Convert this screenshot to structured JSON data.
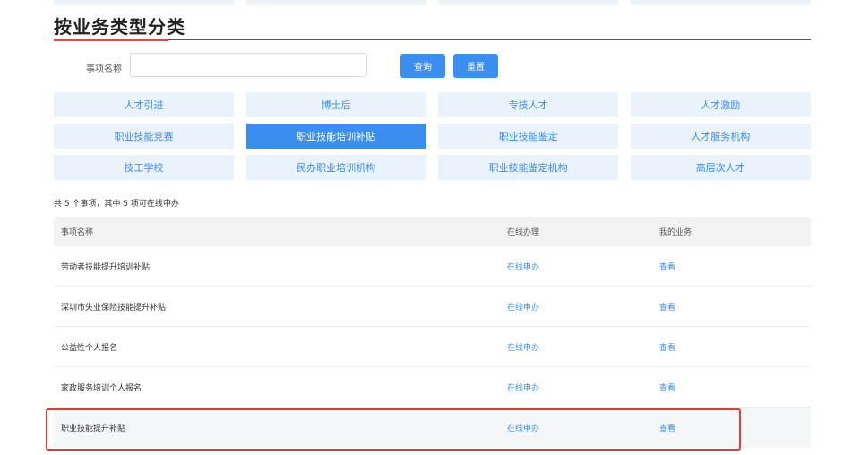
{
  "section": {
    "title": "按业务类型分类"
  },
  "search": {
    "label": "事项名称",
    "value": "",
    "placeholder": ""
  },
  "buttons": {
    "query": "查询",
    "reset": "重置"
  },
  "categories": [
    {
      "label": "人才引进",
      "active": false
    },
    {
      "label": "博士后",
      "active": false
    },
    {
      "label": "专技人才",
      "active": false
    },
    {
      "label": "人才激励",
      "active": false
    },
    {
      "label": "职业技能竞赛",
      "active": false
    },
    {
      "label": "职业技能培训补贴",
      "active": true
    },
    {
      "label": "职业技能鉴定",
      "active": false
    },
    {
      "label": "人才服务机构",
      "active": false
    },
    {
      "label": "技工学校",
      "active": false
    },
    {
      "label": "民办职业培训机构",
      "active": false
    },
    {
      "label": "职业技能鉴定机构",
      "active": false
    },
    {
      "label": "高层次人才",
      "active": false
    }
  ],
  "summary": "共 5 个事项，其中 5 项可在线申办",
  "table": {
    "headers": [
      "事项名称",
      "在线办理",
      "我的业务"
    ],
    "rows": [
      {
        "name": "劳动者技能提升培训补贴",
        "action": "在线申办",
        "view": "查看"
      },
      {
        "name": "深圳市失业保险技能提升补贴",
        "action": "在线申办",
        "view": "查看"
      },
      {
        "name": "公益性个人报名",
        "action": "在线申办",
        "view": "查看"
      },
      {
        "name": "家政服务培训个人报名",
        "action": "在线申办",
        "view": "查看"
      },
      {
        "name": "职业技能提升补贴",
        "action": "在线申办",
        "view": "查看"
      }
    ]
  },
  "colors": {
    "accent": "#3a8ef0",
    "highlight": "#e03b36",
    "title_accent": "#e8453c"
  }
}
